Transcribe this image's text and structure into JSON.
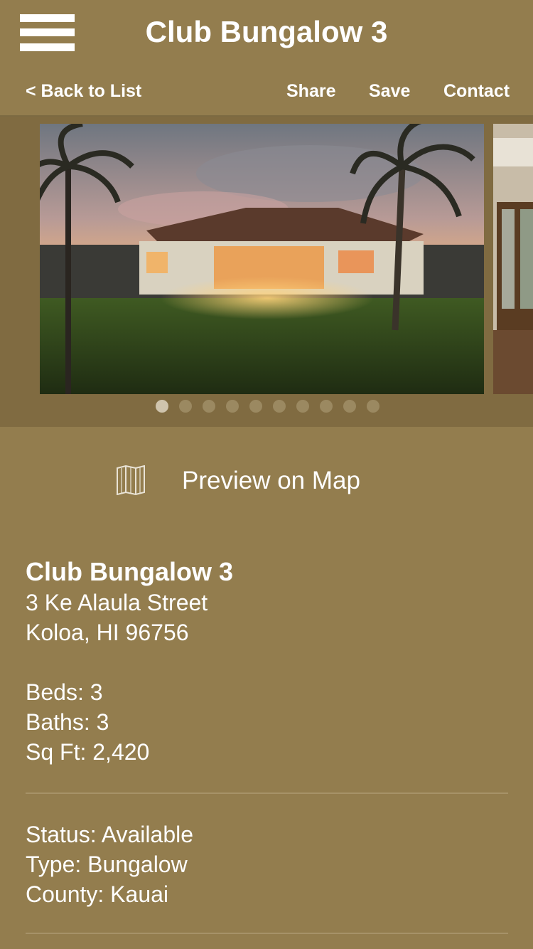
{
  "header": {
    "title": "Club Bungalow 3"
  },
  "subnav": {
    "back": "< Back to List",
    "share": "Share",
    "save": "Save",
    "contact": "Contact"
  },
  "gallery": {
    "slide_count": 10,
    "active_index": 0
  },
  "map": {
    "label": "Preview on Map",
    "icon": "map-icon"
  },
  "property": {
    "name": "Club Bungalow 3",
    "address_line1": "3 Ke Alaula Street",
    "address_line2": "Koloa, HI 96756",
    "beds": "Beds: 3",
    "baths": "Baths: 3",
    "sqft": "Sq Ft: 2,420",
    "status": "Status: Available",
    "type": "Type: Bungalow",
    "county": "County: Kauai"
  },
  "colors": {
    "background": "#937d4e",
    "gallery_bg": "#806b41",
    "text": "#ffffff"
  }
}
